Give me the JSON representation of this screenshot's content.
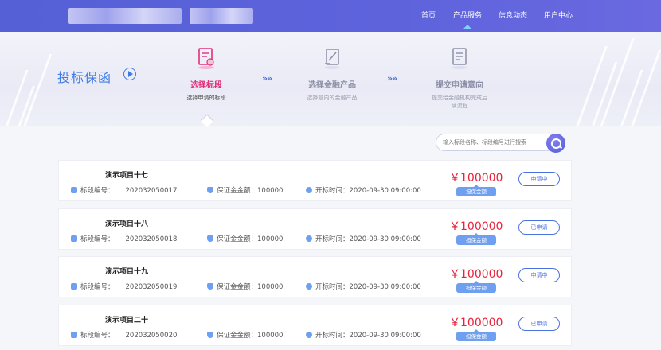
{
  "header": {
    "nav": [
      "首页",
      "产品服务",
      "信息动态",
      "用户中心"
    ],
    "active_nav": "产品服务"
  },
  "hero": {
    "title": "投标保函",
    "steps": [
      {
        "name": "选择标段",
        "sub": "选择申请的标段",
        "icon": "document-certificate-icon"
      },
      {
        "name": "选择金融产品",
        "sub": "选择意向的金融产品",
        "icon": "document-pen-icon"
      },
      {
        "name": "提交申请意向",
        "sub": "提交给金融机构完成后续流程",
        "icon": "document-list-icon"
      }
    ],
    "arrow_glyph": "»»"
  },
  "search": {
    "placeholder": "输入标段名称、标段编号进行搜索"
  },
  "labels": {
    "section_no": "标段编号：",
    "guarantee": "保证金金额：",
    "open_time": "开标时间：",
    "guarantee_tag": "担保金额"
  },
  "projects": [
    {
      "name": "演示项目十七",
      "section_no": "202032050017",
      "guarantee": "100000",
      "open_time": "2020-09-30 09:00:00",
      "price": "￥100000",
      "status": "申请中"
    },
    {
      "name": "演示项目十八",
      "section_no": "202032050018",
      "guarantee": "100000",
      "open_time": "2020-09-30 09:00:00",
      "price": "￥100000",
      "status": "已申请"
    },
    {
      "name": "演示项目十九",
      "section_no": "202032050019",
      "guarantee": "100000",
      "open_time": "2020-09-30 09:00:00",
      "price": "￥100000",
      "status": "申请中"
    },
    {
      "name": "演示项目二十",
      "section_no": "202032050020",
      "guarantee": "100000",
      "open_time": "2020-09-30 09:00:00",
      "price": "￥100000",
      "status": "已申请"
    }
  ],
  "colors": {
    "topbar": "#5a62da",
    "accent": "#3f7be6",
    "active_step": "#e0307a",
    "price": "#e9223b"
  }
}
